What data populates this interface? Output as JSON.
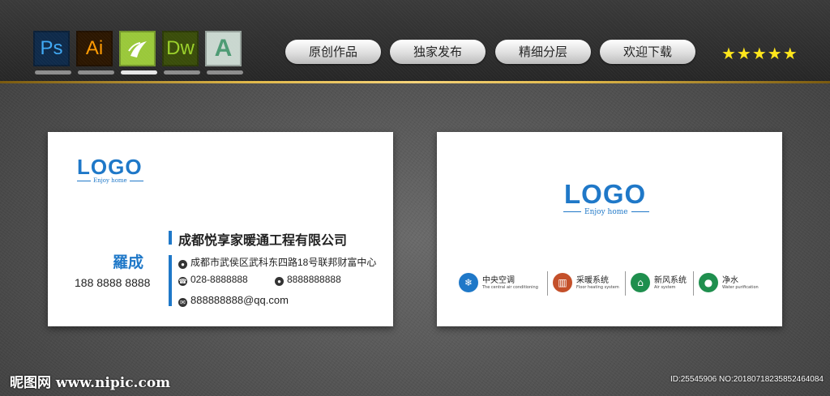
{
  "toolbar": {
    "apps": [
      {
        "label": "Ps",
        "icon": "photoshop-icon"
      },
      {
        "label": "Ai",
        "icon": "illustrator-icon"
      },
      {
        "label": "",
        "icon": "fireworks-icon"
      },
      {
        "label": "Dw",
        "icon": "dreamweaver-icon"
      },
      {
        "label": "A",
        "icon": "autocad-icon"
      }
    ],
    "pills": [
      "原创作品",
      "独家发布",
      "精细分层",
      "欢迎下载"
    ],
    "stars": "★★★★★",
    "accent_gold": "#e0b84a"
  },
  "front_card": {
    "logo": "LOGO",
    "tagline": "Enjoy home",
    "name": "羅成",
    "mobile": "188 8888 8888",
    "company": "成都悦享家暖通工程有限公司",
    "address": "成都市武侯区武科东四路18号联邦财富中心",
    "tel": "028-8888888",
    "qq": "8888888888",
    "email": "888888888@qq.com",
    "brand_color": "#1f78c8"
  },
  "back_card": {
    "logo": "LOGO",
    "tagline": "Enjoy home",
    "services": [
      {
        "title": "中央空调",
        "subtitle": "The central air conditioning",
        "icon": "air-conditioner-icon",
        "color": "#1f78c8"
      },
      {
        "title": "采暖系统",
        "subtitle": "Floor heating system",
        "icon": "radiator-icon",
        "color": "#c4502a"
      },
      {
        "title": "新风系统",
        "subtitle": "Air system",
        "icon": "house-fan-icon",
        "color": "#1f8f4e"
      },
      {
        "title": "净水",
        "subtitle": "Water purification",
        "icon": "water-drop-icon",
        "color": "#1f8f4e"
      }
    ]
  },
  "watermark": {
    "left": "昵图网 www.nipic.com",
    "right": "ID:25545906 NO:20180718235852464084"
  }
}
